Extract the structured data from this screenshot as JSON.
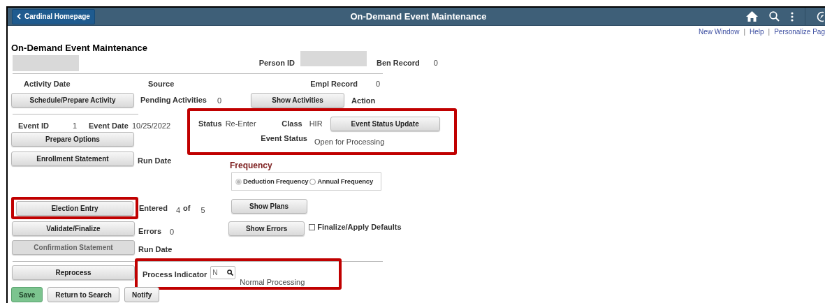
{
  "header": {
    "back_button": "Cardinal Homepage",
    "title": "On-Demand Event Maintenance"
  },
  "links": [
    {
      "label": "New Window",
      "separator": "|"
    },
    {
      "label": "Help",
      "separator": "|"
    },
    {
      "label": "Personalize Pag"
    }
  ],
  "page_title": "On-Demand Event Maintenance",
  "person": {
    "person_id_label": "Person ID",
    "ben_record_label": "Ben Record",
    "ben_record": "0"
  },
  "activity": {
    "activity_date_label": "Activity Date",
    "source_label": "Source",
    "empl_record_label": "Empl Record",
    "empl_record": "0",
    "schedule_button": {
      "label": "Schedule/Prepare Activity",
      "disabled": false
    },
    "pending_label": "Pending Activities",
    "pending": "0",
    "show_activities_button": {
      "label": "Show Activities",
      "disabled": false
    },
    "action_label": "Action"
  },
  "event": {
    "event_id_label": "Event ID",
    "event_id": "1",
    "event_date_label": "Event Date",
    "event_date": "10/25/2022",
    "prepare_button": {
      "label": "Prepare Options",
      "disabled": false
    },
    "enrollment_button": {
      "label": "Enrollment Statement",
      "disabled": false
    },
    "run_date_label": "Run Date"
  },
  "status": {
    "highlighted": true,
    "status_label": "Status",
    "status": "Re-Enter",
    "class_label": "Class",
    "class": "HIR",
    "update_button": {
      "label": "Event Status Update",
      "disabled": false
    },
    "event_status_label": "Event Status",
    "event_status": "Open for Processing"
  },
  "frequency": {
    "label": "Frequency",
    "options": [
      {
        "label": "Deduction Frequency",
        "selected": true,
        "disabled": true
      },
      {
        "label": "Annual Frequency",
        "selected": false,
        "disabled": false
      }
    ]
  },
  "election": {
    "entry_button": {
      "label": "Election Entry",
      "disabled": false,
      "highlighted": true
    },
    "entered_label": "Entered",
    "entered": "4",
    "of_label": "of",
    "total": "5",
    "show_plans_button": {
      "label": "Show Plans",
      "disabled": false
    },
    "validate_button": {
      "label": "Validate/Finalize",
      "disabled": false
    },
    "errors_label": "Errors",
    "errors": "0",
    "show_errors_button": {
      "label": "Show Errors",
      "disabled": false
    },
    "finalize_checkbox": {
      "label": "Finalize/Apply Defaults",
      "checked": false
    },
    "confirmation_button": {
      "label": "Confirmation Statement",
      "disabled": true
    },
    "run_date_label": "Run Date"
  },
  "process": {
    "reprocess_button": {
      "label": "Reprocess",
      "disabled": false
    },
    "highlighted": true,
    "indicator_label": "Process Indicator",
    "indicator": "N",
    "indicator_description": "Normal Processing"
  },
  "footer_buttons": [
    {
      "label": "Save",
      "kind": "primary"
    },
    {
      "label": "Return to Search",
      "kind": "normal"
    },
    {
      "label": "Notify",
      "kind": "normal"
    }
  ]
}
